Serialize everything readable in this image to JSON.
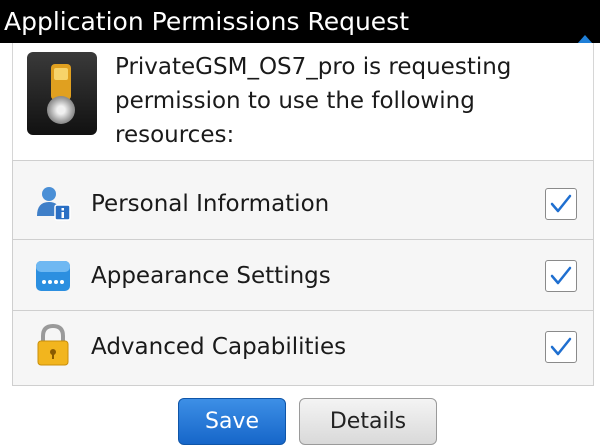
{
  "dialog": {
    "title": "Application Permissions Request",
    "request_message": "PrivateGSM_OS7_pro is requesting permission to use the following resources:"
  },
  "permissions": [
    {
      "label": "Personal Information",
      "checked": true,
      "icon": "person-info-icon"
    },
    {
      "label": "Appearance Settings",
      "checked": true,
      "icon": "appearance-settings-icon"
    },
    {
      "label": "Advanced Capabilities",
      "checked": true,
      "icon": "padlock-icon"
    }
  ],
  "buttons": {
    "save_label": "Save",
    "details_label": "Details"
  },
  "colors": {
    "title_bar": "#000000",
    "save_button": "#1f75d6",
    "checkmark": "#1f6fd0"
  }
}
